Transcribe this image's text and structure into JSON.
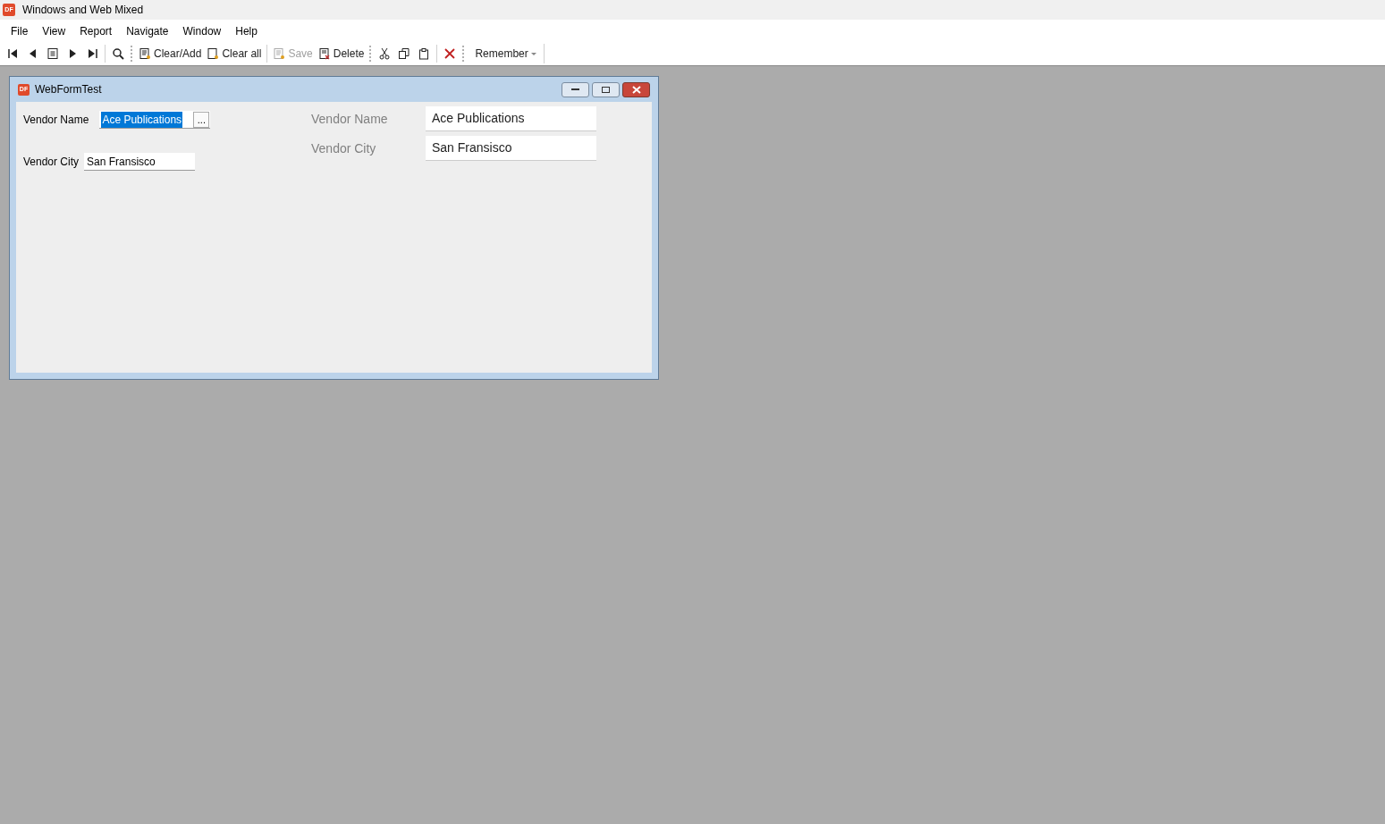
{
  "window": {
    "logo": "DF",
    "title": "Windows and Web Mixed"
  },
  "menu": [
    "File",
    "View",
    "Report",
    "Navigate",
    "Window",
    "Help"
  ],
  "toolbar": [
    {
      "kind": "icon"
    },
    {
      "kind": "icon"
    },
    {
      "kind": "icon"
    },
    {
      "kind": "icon"
    },
    {
      "kind": "icon"
    },
    {
      "kind": "sep"
    },
    {
      "kind": "icon"
    },
    {
      "kind": "grip"
    },
    {
      "kind": "text",
      "label": "Clear/Add",
      "disabled": false
    },
    {
      "kind": "text",
      "label": "Clear all",
      "disabled": false
    },
    {
      "kind": "sep"
    },
    {
      "kind": "text",
      "label": "Save",
      "disabled": true
    },
    {
      "kind": "text",
      "label": "Delete",
      "disabled": false
    },
    {
      "kind": "grip"
    },
    {
      "kind": "icon"
    },
    {
      "kind": "icon"
    },
    {
      "kind": "icon"
    },
    {
      "kind": "sep"
    },
    {
      "kind": "icon"
    },
    {
      "kind": "grip"
    },
    {
      "kind": "dropdown",
      "label": "Remember"
    }
  ],
  "child_window": {
    "logo": "DF",
    "title": "WebFormTest",
    "windows_form": [
      {
        "label": "Vendor Name",
        "value": "Ace Publications",
        "selected": true,
        "lookup": "..."
      },
      {
        "label": "Vendor City",
        "value": "San Fransisco",
        "selected": false
      }
    ],
    "web_form": [
      {
        "label": "Vendor Name",
        "value": "Ace Publications"
      },
      {
        "label": "Vendor City",
        "value": "San Fransisco"
      }
    ]
  }
}
